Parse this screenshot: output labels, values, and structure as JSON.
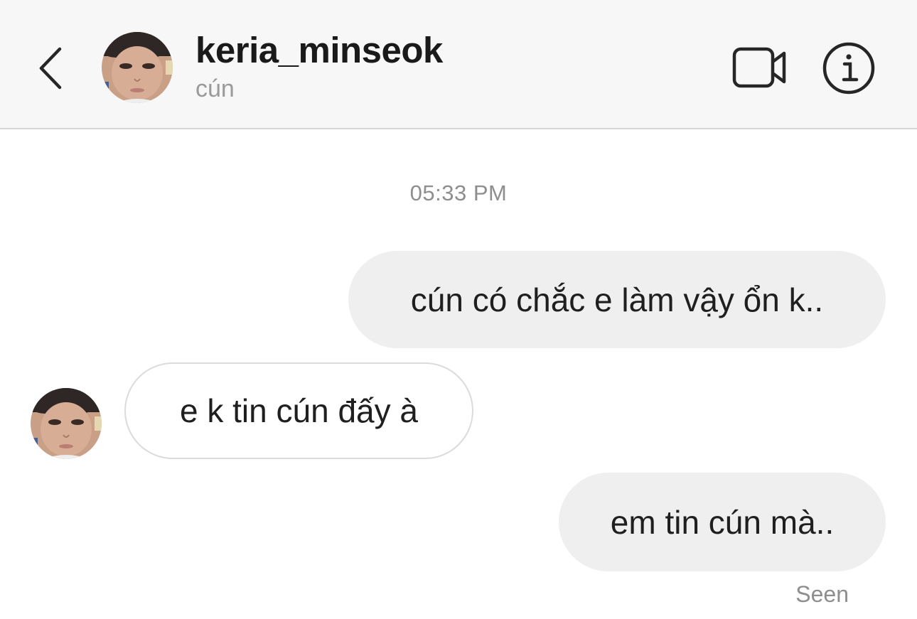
{
  "header": {
    "username": "keria_minseok",
    "subtitle": "cún",
    "icons": {
      "back": "chevron-left-icon",
      "video": "video-camera-icon",
      "info": "info-icon"
    }
  },
  "thread": {
    "timestamp": "05:33 PM",
    "messages": [
      {
        "direction": "outgoing",
        "text": "cún có chắc e làm vậy ổn k.."
      },
      {
        "direction": "incoming",
        "text": "e k tin cún đấy à"
      },
      {
        "direction": "outgoing",
        "text": "em tin cún mà.."
      }
    ],
    "seen_label": "Seen"
  },
  "colors": {
    "header_bg": "#f7f7f7",
    "outgoing_bubble": "#efefef",
    "incoming_border": "#dbdbdb",
    "muted_text": "#8e8e8e"
  }
}
